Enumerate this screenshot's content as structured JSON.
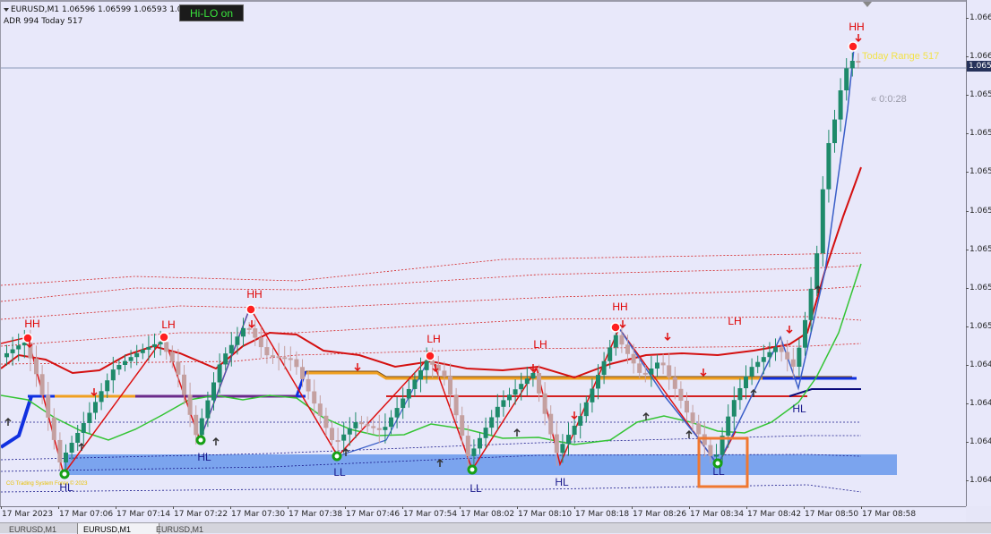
{
  "header": {
    "symbol_line": "EURUSD,M1  1.06596 1.06599 1.06593 1.065",
    "adr_line": "ADR 994  Today 517"
  },
  "hilo_button": "Hi-LO on",
  "today_range": "Today Range   517",
  "countdown": "« 0:0:28",
  "copyright": "CG Trading System Forex © 2023",
  "current_price": "1.065",
  "price_axis": [
    "1.066",
    "1.066",
    "1.065",
    "1.065",
    "1.065",
    "1.065",
    "1.065",
    "1.065",
    "1.065",
    "1.064",
    "1.064",
    "1.064",
    "1.064",
    "1.064"
  ],
  "time_axis": [
    "17 Mar 2023",
    "17 Mar 07:06",
    "17 Mar 07:14",
    "17 Mar 07:22",
    "17 Mar 07:30",
    "17 Mar 07:38",
    "17 Mar 07:46",
    "17 Mar 07:54",
    "17 Mar 08:02",
    "17 Mar 08:10",
    "17 Mar 08:18",
    "17 Mar 08:26",
    "17 Mar 08:34",
    "17 Mar 08:42",
    "17 Mar 08:50",
    "17 Mar 08:58"
  ],
  "tabs": [
    "EURUSD,M1",
    "EURUSD,M1",
    "EURUSD,M1"
  ],
  "swing_labels": [
    "HH",
    "HL",
    "LH",
    "HL",
    "HH",
    "LL",
    "LH",
    "LL",
    "LH",
    "HL",
    "HH",
    "LL",
    "LH",
    "HL",
    "HH",
    "HH"
  ],
  "colors": {
    "background": "#e8e8fa",
    "bull_candle": "#1e8a6a",
    "bear_candle": "#c4a0a0",
    "zigzag_red": "#dd1111",
    "zigzag_blue": "#3a5ec8",
    "ma_red": "#d41010",
    "ma_green": "#34c434",
    "support_zone": "#6f9cec",
    "resistance_line": "#d42020",
    "orange_line": "#f0a020",
    "blue_line": "#1030e0",
    "navy_line": "#0a0a7a",
    "highlight_box": "#f07830"
  }
}
